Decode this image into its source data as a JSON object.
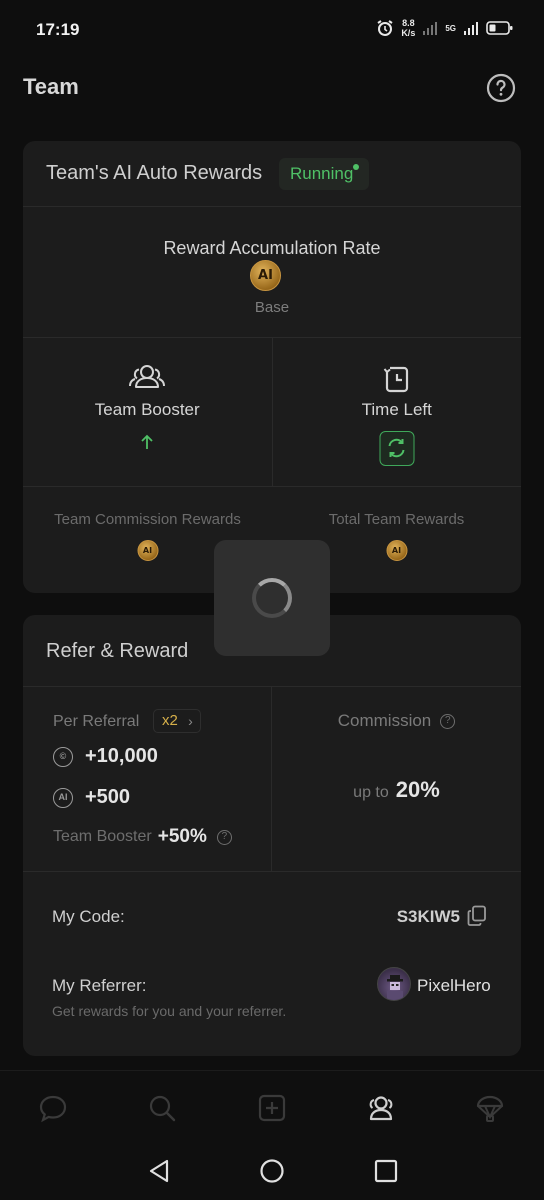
{
  "status_bar": {
    "time": "17:19",
    "net_speed_value": "8.8",
    "net_speed_unit": "K/s",
    "network_type": "5G",
    "icons": [
      "alarm-icon",
      "signal-icon",
      "battery-icon"
    ]
  },
  "header": {
    "title": "Team",
    "help_icon": "question-circle-icon"
  },
  "ai_rewards": {
    "title": "Team's AI Auto Rewards",
    "status": "Running",
    "rate_label": "Reward Accumulation Rate",
    "coin_text": "AI",
    "rate_sub": "Base",
    "team_booster_label": "Team Booster",
    "time_left_label": "Time Left",
    "commission_label": "Team Commission Rewards",
    "total_label": "Total Team Rewards"
  },
  "refer": {
    "title": "Refer & Reward",
    "per_referral_label": "Per Referral",
    "multiplier": "x2",
    "reward_1": "+10,000",
    "reward_2": "+500",
    "booster_label": "Team Booster",
    "booster_value": "+50%",
    "commission_label": "Commission",
    "up_to_label": "up to",
    "commission_value": "20%",
    "my_code_label": "My Code:",
    "my_code_value": "S3KIW5",
    "referrer_label": "My Referrer:",
    "referrer_sub": "Get rewards for you and your referrer.",
    "referrer_name": "PixelHero"
  },
  "colors": {
    "accent_green": "#4fc066",
    "gold": "#d6b04a",
    "background": "#0e0e0e",
    "card": "#1c1c1c"
  },
  "bottom_nav": [
    "chat-icon",
    "search-icon",
    "add-icon",
    "team-icon",
    "airdrop-icon"
  ]
}
